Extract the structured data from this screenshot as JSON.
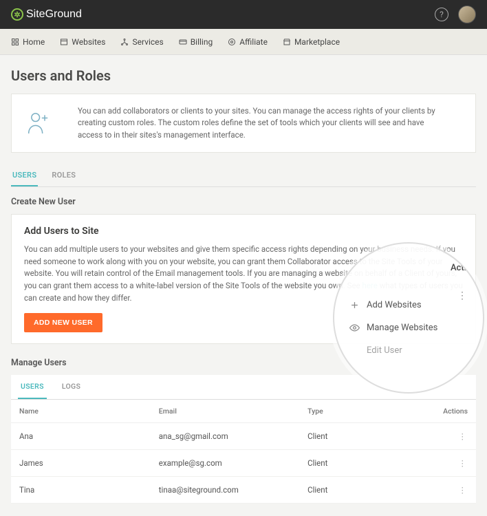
{
  "brand": "SiteGround",
  "nav": {
    "home": "Home",
    "websites": "Websites",
    "services": "Services",
    "billing": "Billing",
    "affiliate": "Affiliate",
    "marketplace": "Marketplace"
  },
  "page": {
    "title": "Users and Roles",
    "intro": "You can add collaborators or clients to your sites. You can manage the access rights of your clients by creating custom roles. The custom roles define the set of tools which your clients will see and have access to in their sites's management interface."
  },
  "tabs": {
    "users": "USERS",
    "roles": "ROLES"
  },
  "createSection": "Create New User",
  "addCard": {
    "title": "Add Users to Site",
    "body_pre": "You can add multiple users to your websites and give them specific access rights depending on your business needs. If you need someone to work along with you on your website, you can grant them Collaborator access to the Site Tools of your website. You will retain control of the Email management tools. If you are managing a website on behalf of a Client of yours, you can grant them access to a white-label version of the Site Tools of the website you own. See ",
    "link": "here",
    "body_post": " what types of users you can create and how they differ.",
    "button": "ADD NEW USER"
  },
  "manageSection": "Manage Users",
  "subtabs": {
    "users": "USERS",
    "logs": "LOGS"
  },
  "table": {
    "headers": {
      "name": "Name",
      "email": "Email",
      "type": "Type",
      "actions": "Actions"
    },
    "rows": [
      {
        "name": "Ana",
        "email": "ana_sg@gmail.com",
        "type": "Client"
      },
      {
        "name": "James",
        "email": "example@sg.com",
        "type": "Client"
      },
      {
        "name": "Tina",
        "email": "tinaa@siteground.com",
        "type": "Client"
      }
    ]
  },
  "magnifier": {
    "actions_label": "Acti",
    "items": {
      "add": "Add Websites",
      "manage": "Manage Websites",
      "edit": "Edit User"
    }
  }
}
